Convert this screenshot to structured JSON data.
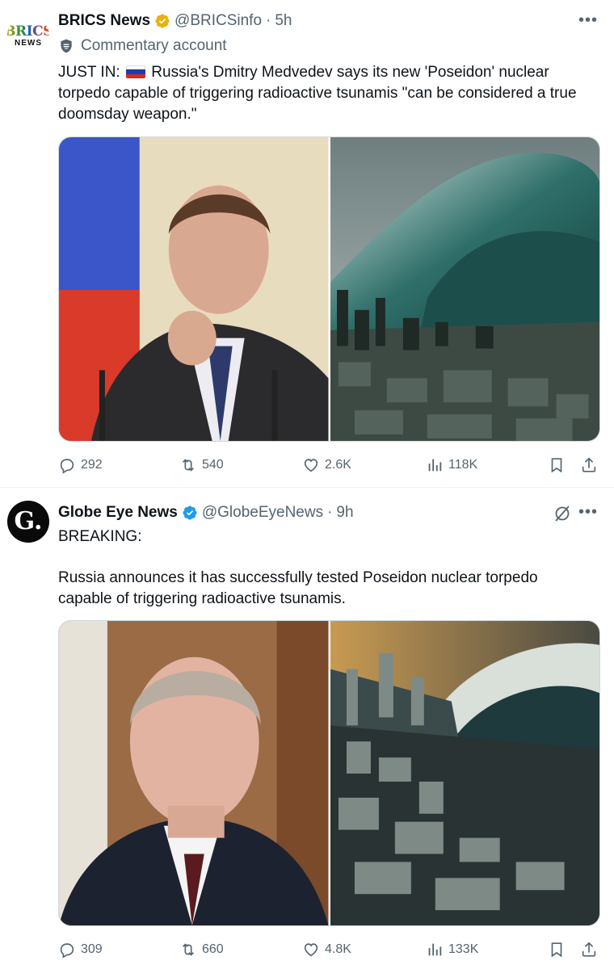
{
  "tweets": [
    {
      "avatar": {
        "line1": "BRICS",
        "line2": "NEWS"
      },
      "name": "BRICS News",
      "handle": "@BRICSinfo",
      "separator": "·",
      "time": "5h",
      "commentary": "Commentary account",
      "text_prefix": "JUST IN:",
      "text_body": "Russia's Dmitry Medvedev says its new 'Poseidon' nuclear torpedo capable of triggering radioactive tsunamis \"can be considered a true doomsday weapon.\"",
      "replies": "292",
      "reposts": "540",
      "likes": "2.6K",
      "views": "118K"
    },
    {
      "avatar": {
        "line1": "G."
      },
      "name": "Globe Eye News",
      "handle": "@GlobeEyeNews",
      "separator": "·",
      "time": "9h",
      "text_line1": "BREAKING:",
      "text_line2": "Russia announces it has successfully tested Poseidon nuclear torpedo capable of triggering radioactive tsunamis.",
      "replies": "309",
      "reposts": "660",
      "likes": "4.8K",
      "views": "133K"
    }
  ],
  "colors": {
    "verified_gold": "#e8b20c",
    "verified_blue": "#1d9bf0",
    "text": "#0f1419",
    "secondary": "#536471"
  },
  "icons": [
    "verified-gold-icon",
    "verified-blue-icon",
    "commentary-shield-icon",
    "russia-flag-icon",
    "reply-icon",
    "repost-icon",
    "like-icon",
    "views-icon",
    "bookmark-icon",
    "share-icon",
    "grok-icon",
    "more-icon"
  ]
}
